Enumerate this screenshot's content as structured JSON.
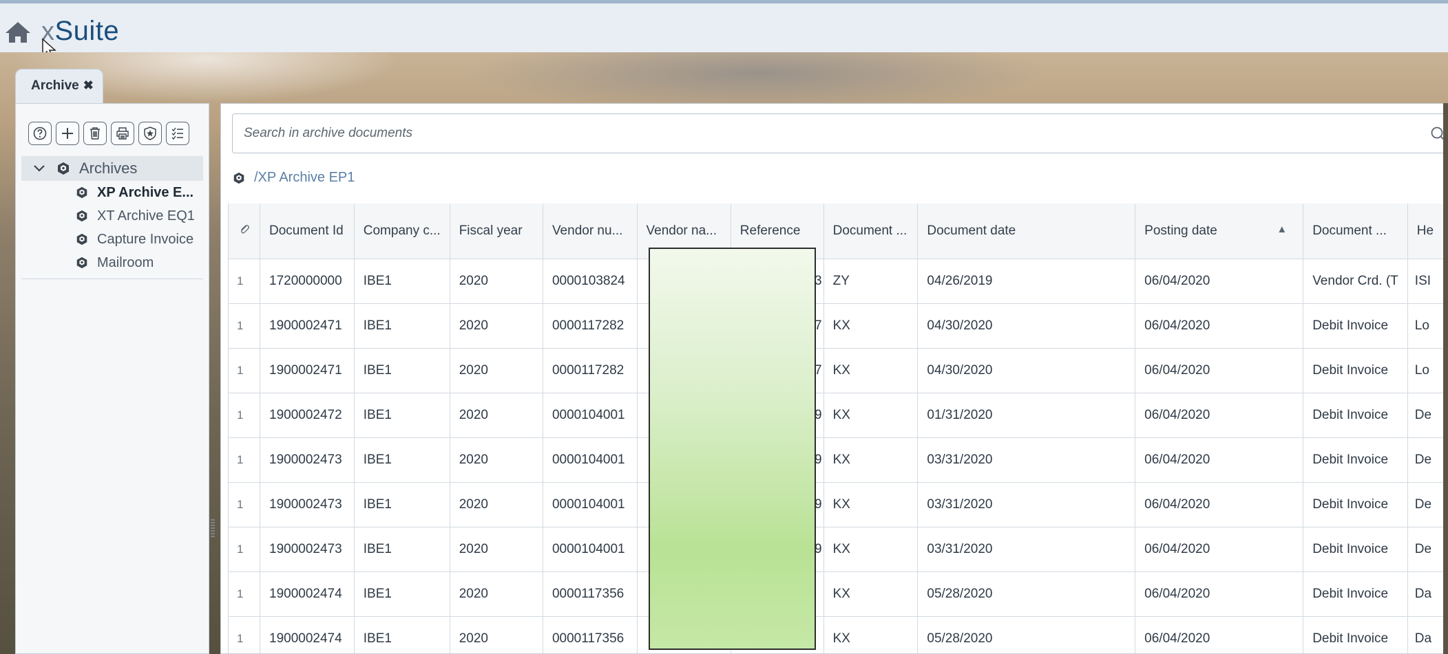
{
  "header": {
    "logo_x": "x",
    "logo_suite": "Suite"
  },
  "tab": {
    "label": "Archive",
    "close": "✖"
  },
  "sidebar": {
    "toolbar": [
      "help-icon",
      "add-icon",
      "delete-icon",
      "print-icon",
      "shield-icon",
      "checklist-icon"
    ],
    "root_label": "Archives",
    "items": [
      {
        "label": "XP Archive E..."
      },
      {
        "label": "XT Archive EQ1"
      },
      {
        "label": "Capture Invoice"
      },
      {
        "label": "Mailroom"
      }
    ]
  },
  "search": {
    "placeholder": "Search in archive documents"
  },
  "breadcrumb": "/XP Archive EP1",
  "table": {
    "columns": [
      "Document Id",
      "Company c...",
      "Fiscal year",
      "Vendor nu...",
      "Vendor na...",
      "Reference",
      "Document ...",
      "Document date",
      "Posting date",
      "Document ...",
      "He"
    ],
    "sort_indicator": "▲",
    "rows": [
      {
        "n": "1",
        "doc_id": "1720000000",
        "company": "IBE1",
        "fiscal": "2020",
        "vendor_no": "0000103824",
        "vendor_name": "",
        "reference": "33",
        "doc_type": "ZY",
        "doc_date": "04/26/2019",
        "post_date": "06/04/2020",
        "doc_kind": "Vendor Crd. (T",
        "he": "ISI"
      },
      {
        "n": "1",
        "doc_id": "1900002471",
        "company": "IBE1",
        "fiscal": "2020",
        "vendor_no": "0000117282",
        "vendor_name": "",
        "reference": "687",
        "doc_type": "KX",
        "doc_date": "04/30/2020",
        "post_date": "06/04/2020",
        "doc_kind": "Debit Invoice",
        "he": "Lo"
      },
      {
        "n": "1",
        "doc_id": "1900002471",
        "company": "IBE1",
        "fiscal": "2020",
        "vendor_no": "0000117282",
        "vendor_name": "",
        "reference": "687",
        "doc_type": "KX",
        "doc_date": "04/30/2020",
        "post_date": "06/04/2020",
        "doc_kind": "Debit Invoice",
        "he": "Lo"
      },
      {
        "n": "1",
        "doc_id": "1900002472",
        "company": "IBE1",
        "fiscal": "2020",
        "vendor_no": "0000104001",
        "vendor_name": "",
        "reference": "9",
        "doc_type": "KX",
        "doc_date": "01/31/2020",
        "post_date": "06/04/2020",
        "doc_kind": "Debit Invoice",
        "he": "De"
      },
      {
        "n": "1",
        "doc_id": "1900002473",
        "company": "IBE1",
        "fiscal": "2020",
        "vendor_no": "0000104001",
        "vendor_name": "",
        "reference": "9",
        "doc_type": "KX",
        "doc_date": "03/31/2020",
        "post_date": "06/04/2020",
        "doc_kind": "Debit Invoice",
        "he": "De"
      },
      {
        "n": "1",
        "doc_id": "1900002473",
        "company": "IBE1",
        "fiscal": "2020",
        "vendor_no": "0000104001",
        "vendor_name": "",
        "reference": "9",
        "doc_type": "KX",
        "doc_date": "03/31/2020",
        "post_date": "06/04/2020",
        "doc_kind": "Debit Invoice",
        "he": "De"
      },
      {
        "n": "1",
        "doc_id": "1900002473",
        "company": "IBE1",
        "fiscal": "2020",
        "vendor_no": "0000104001",
        "vendor_name": "",
        "reference": "9",
        "doc_type": "KX",
        "doc_date": "03/31/2020",
        "post_date": "06/04/2020",
        "doc_kind": "Debit Invoice",
        "he": "De"
      },
      {
        "n": "1",
        "doc_id": "1900002474",
        "company": "IBE1",
        "fiscal": "2020",
        "vendor_no": "0000117356",
        "vendor_name": "",
        "reference": "",
        "doc_type": "KX",
        "doc_date": "05/28/2020",
        "post_date": "06/04/2020",
        "doc_kind": "Debit Invoice",
        "he": "Da"
      },
      {
        "n": "1",
        "doc_id": "1900002474",
        "company": "IBE1",
        "fiscal": "2020",
        "vendor_no": "0000117356",
        "vendor_name": "",
        "reference": "",
        "doc_type": "KX",
        "doc_date": "05/28/2020",
        "post_date": "06/04/2020",
        "doc_kind": "Debit Invoice",
        "he": "Da"
      }
    ]
  }
}
